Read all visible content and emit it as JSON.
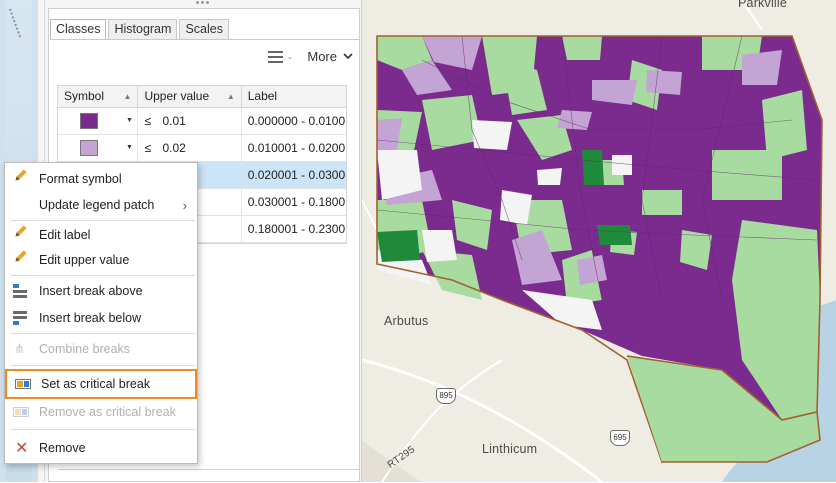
{
  "tabs": [
    "Classes",
    "Histogram",
    "Scales"
  ],
  "toolbar": {
    "more_label": "More",
    "list_icon": "list-view-icon"
  },
  "table": {
    "headers": {
      "symbol": "Symbol",
      "upper": "Upper value",
      "label": "Label"
    },
    "rows": [
      {
        "color": "#7b2a8e",
        "op": "≤",
        "upper": "0.01",
        "label": "0.000000 - 0.0100..."
      },
      {
        "color": "#c4a4d4",
        "op": "≤",
        "upper": "0.02",
        "label": "0.010001 - 0.0200..."
      },
      {
        "color": "#f4f4f4",
        "op": "",
        "upper": "",
        "label": "0.020001 - 0.0300..."
      },
      {
        "color": "#a8dba0",
        "op": "",
        "upper": "",
        "label": "0.030001 - 0.1800..."
      },
      {
        "color": "#1f8a3a",
        "op": "",
        "upper": "",
        "label": "0.180001 - 0.2300..."
      }
    ]
  },
  "menu": {
    "format_symbol": "Format symbol",
    "update_legend_patch": "Update legend patch",
    "edit_label": "Edit label",
    "edit_upper_value": "Edit upper value",
    "insert_break_above": "Insert break above",
    "insert_break_below": "Insert break below",
    "combine_breaks": "Combine breaks",
    "set_critical_break": "Set as critical break",
    "remove_critical_break": "Remove as critical break",
    "remove": "Remove"
  },
  "map": {
    "labels": {
      "parkville": "Parkville",
      "arbutus": "Arbutus",
      "linthicum": "Linthicum",
      "rt295": "RT295"
    },
    "shields": [
      "895",
      "695"
    ],
    "colors": {
      "dark_purple": "#7b2a8e",
      "light_purple": "#c4a4d4",
      "light_green": "#a8dba0",
      "dark_green": "#1f8a3a",
      "white": "#f4f4f4",
      "boundary": "#a0622f"
    }
  }
}
